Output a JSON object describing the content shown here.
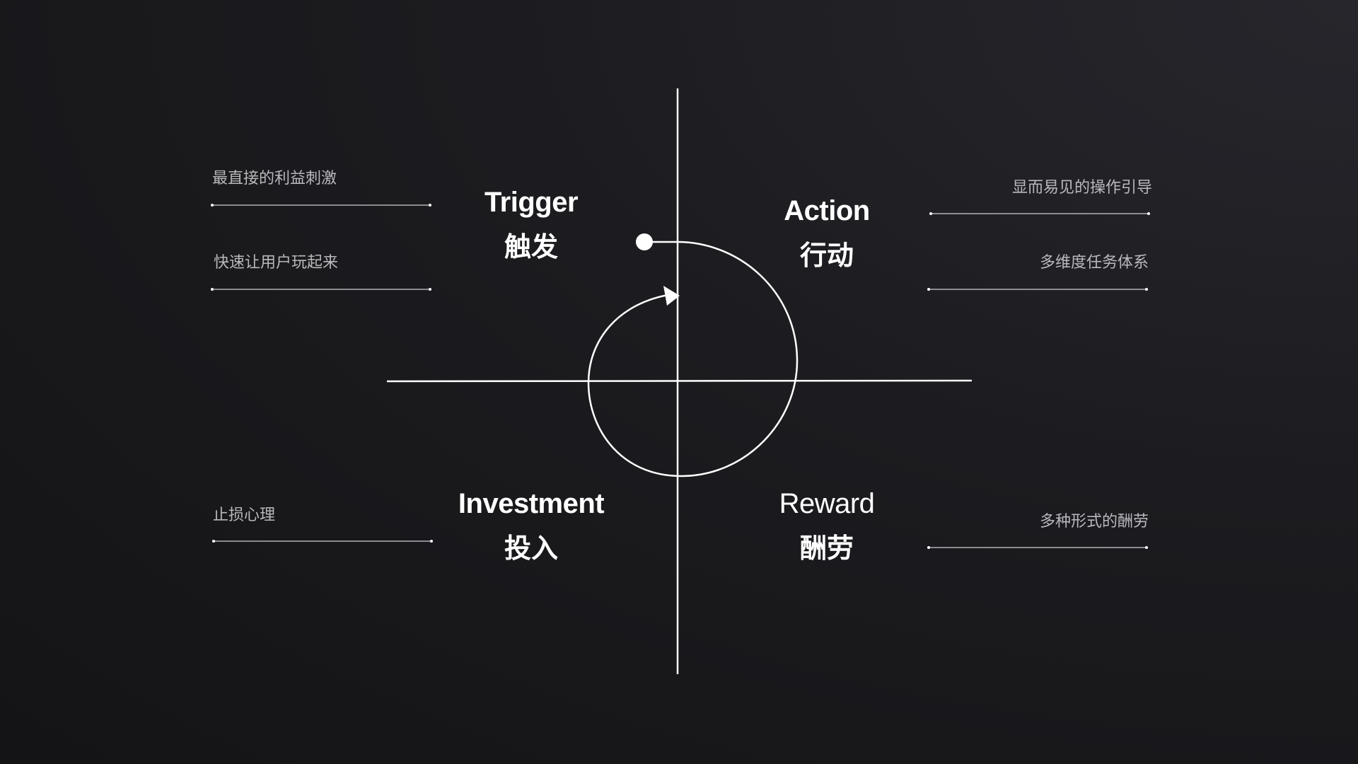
{
  "colors": {
    "background": "#1c1c20",
    "line": "#ffffff",
    "note_text": "#b9b9bd",
    "title_text": "#ffffff"
  },
  "stages": {
    "trigger": {
      "en": "Trigger",
      "zh": "触发"
    },
    "action": {
      "en": "Action",
      "zh": "行动"
    },
    "investment": {
      "en": "Investment",
      "zh": "投入"
    },
    "reward": {
      "en": "Reward",
      "zh": "酬劳"
    }
  },
  "notes": {
    "trigger": [
      "最直接的利益刺激",
      "快速让用户玩起来"
    ],
    "action": [
      "显而易见的操作引导",
      "多维度任务体系"
    ],
    "investment": [
      "止损心理"
    ],
    "reward": [
      "多种形式的酬劳"
    ]
  },
  "icons": {
    "cycle": "loop-arrow-icon",
    "start": "start-dot-icon"
  }
}
